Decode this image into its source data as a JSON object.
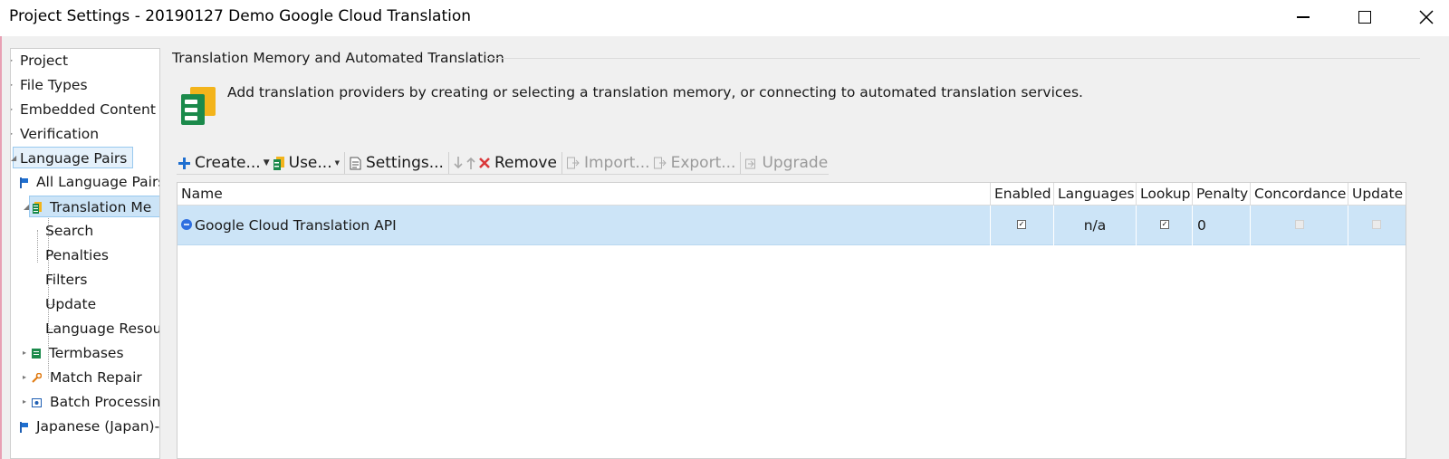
{
  "window": {
    "title": "Project Settings - 20190127 Demo Google Cloud Translation"
  },
  "tree": {
    "items": [
      {
        "label": "Project"
      },
      {
        "label": "File Types"
      },
      {
        "label": "Embedded Content"
      },
      {
        "label": "Verification"
      },
      {
        "label": "Language Pairs"
      },
      {
        "label": "All Language Pairs"
      },
      {
        "label": "Translation Me"
      },
      {
        "label": "Search"
      },
      {
        "label": "Penalties"
      },
      {
        "label": "Filters"
      },
      {
        "label": "Update"
      },
      {
        "label": "Language Resou"
      },
      {
        "label": "Termbases"
      },
      {
        "label": "Match Repair"
      },
      {
        "label": "Batch Processin"
      },
      {
        "label": "Japanese (Japan)-"
      }
    ]
  },
  "main": {
    "section_title": "Translation Memory and Automated Translation",
    "description": "Add translation providers by creating or selecting a translation memory, or connecting to automated translation services."
  },
  "toolbar": {
    "create_label": "Create...",
    "use_label": "Use...",
    "settings_label": "Settings...",
    "remove_label": "Remove",
    "import_label": "Import...",
    "export_label": "Export...",
    "upgrade_label": "Upgrade"
  },
  "grid": {
    "columns": [
      "Name",
      "Enabled",
      "Languages",
      "Lookup",
      "Penalty",
      "Concordance",
      "Update"
    ],
    "rows": [
      {
        "name": "Google Cloud Translation API",
        "enabled": true,
        "languages": "n/a",
        "lookup": true,
        "penalty": "0",
        "concordance": false,
        "update": false
      }
    ]
  },
  "colors": {
    "selection": "#cce4f7",
    "accent": "#1f6fd0",
    "remove_icon": "#d9383a"
  }
}
